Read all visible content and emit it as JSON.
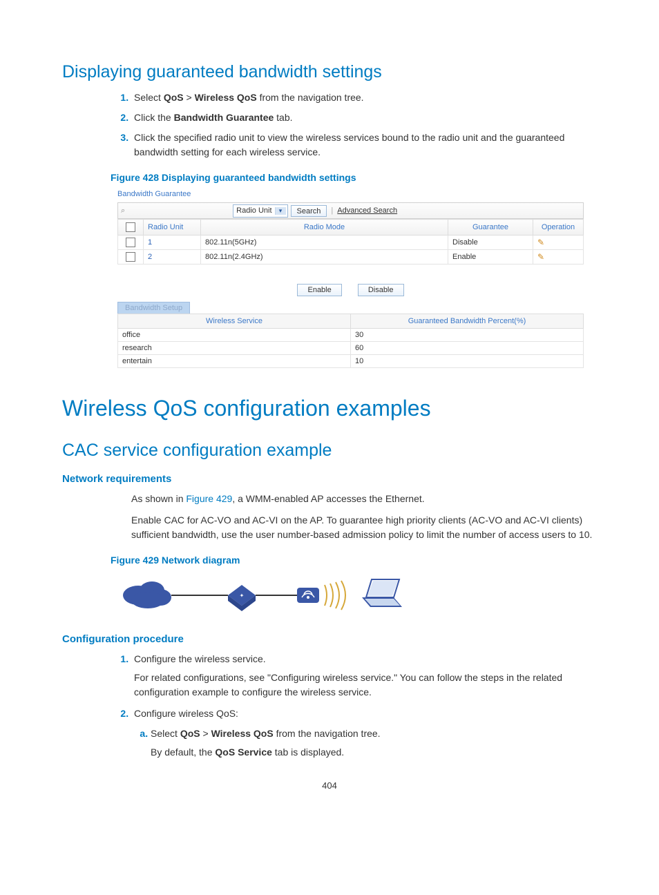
{
  "page_number": "404",
  "heading1": "Displaying guaranteed bandwidth settings",
  "steps1": {
    "s1_pre": "Select ",
    "s1_b1": "QoS",
    "s1_mid": " > ",
    "s1_b2": "Wireless QoS",
    "s1_post": " from the navigation tree.",
    "s2_pre": "Click the ",
    "s2_b": "Bandwidth Guarantee",
    "s2_post": " tab.",
    "s3": "Click the specified radio unit to view the wireless services bound to the radio unit and the guaranteed bandwidth setting for each wireless service."
  },
  "figure428_caption": "Figure 428 Displaying guaranteed bandwidth settings",
  "fig428": {
    "tab_title": "Bandwidth Guarantee",
    "dropdown_label": "Radio Unit",
    "search_btn": "Search",
    "advanced_link": "Advanced Search",
    "grid": {
      "headers": {
        "c0": "",
        "c1": "Radio Unit",
        "c2": "Radio Mode",
        "c3": "Guarantee",
        "c4": "Operation"
      },
      "rows": [
        {
          "unit": "1",
          "mode": "802.11n(5GHz)",
          "guarantee": "Disable"
        },
        {
          "unit": "2",
          "mode": "802.11n(2.4GHz)",
          "guarantee": "Enable"
        }
      ]
    },
    "enable_btn": "Enable",
    "disable_btn": "Disable",
    "setup_tab": "Bandwidth Setup",
    "setup": {
      "headers": {
        "c1": "Wireless Service",
        "c2": "Guaranteed Bandwidth Percent(%)"
      },
      "rows": [
        {
          "service": "office",
          "percent": "30"
        },
        {
          "service": "research",
          "percent": "60"
        },
        {
          "service": "entertain",
          "percent": "10"
        }
      ]
    }
  },
  "heading2": "Wireless QoS configuration examples",
  "heading3": "CAC service configuration example",
  "netreq_title": "Network requirements",
  "netreq_p1_pre": "As shown in ",
  "netreq_p1_link": "Figure 429",
  "netreq_p1_post": ", a WMM-enabled AP accesses the Ethernet.",
  "netreq_p2": "Enable CAC for AC-VO and AC-VI on the AP. To guarantee high priority clients (AC-VO and AC-VI clients) sufficient bandwidth, use the user number-based admission policy to limit the number of access users to 10.",
  "figure429_caption": "Figure 429 Network diagram",
  "cfgproc_title": "Configuration procedure",
  "cfgproc": {
    "s1": "Configure the wireless service.",
    "s1_note": "For related configurations, see \"Configuring wireless service.\" You can follow the steps in the related configuration example to configure the wireless service.",
    "s2": "Configure wireless QoS:",
    "s2a_pre": "Select ",
    "s2a_b1": "QoS",
    "s2a_mid": " > ",
    "s2a_b2": "Wireless QoS",
    "s2a_post": " from the navigation tree.",
    "s2a_note_pre": "By default, the ",
    "s2a_note_b": "QoS Service",
    "s2a_note_post": " tab is displayed."
  }
}
